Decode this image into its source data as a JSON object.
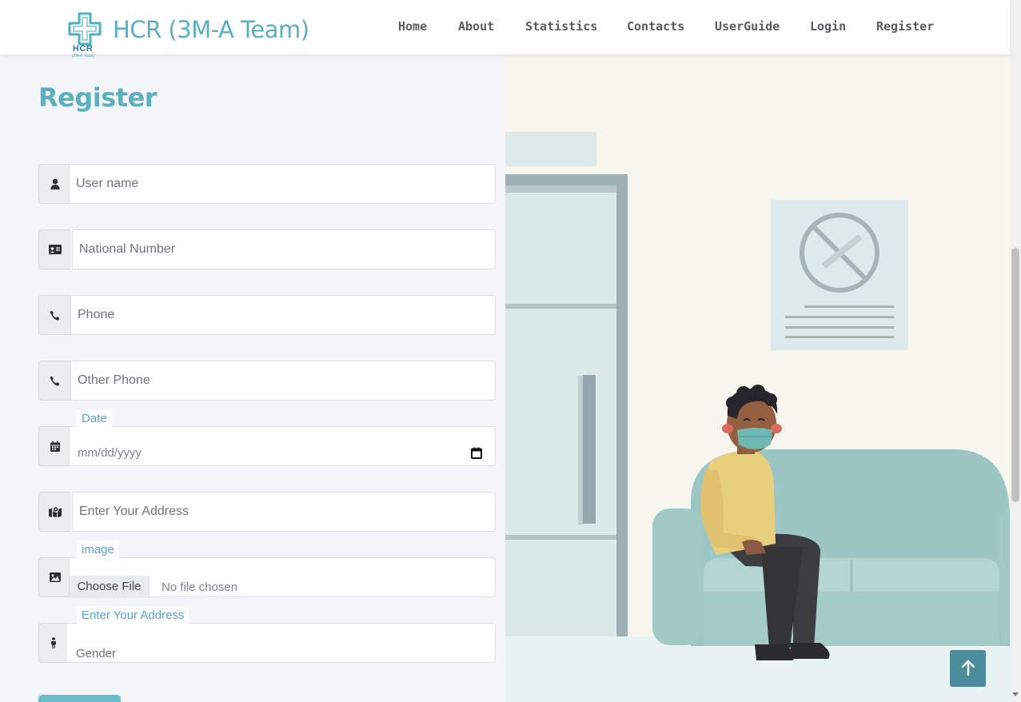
{
  "brand": {
    "logo_text": "HCR",
    "logo_subtext": "(3M-A Team)",
    "title": "HCR (3M-A Team)"
  },
  "nav": {
    "items": [
      {
        "label": "Home"
      },
      {
        "label": "About"
      },
      {
        "label": "Statistics"
      },
      {
        "label": "Contacts"
      },
      {
        "label": "UserGuide"
      },
      {
        "label": "Login"
      },
      {
        "label": "Register"
      }
    ]
  },
  "form": {
    "title": "Register",
    "username": {
      "placeholder": "User name"
    },
    "national_number": {
      "placeholder": "National Number"
    },
    "phone": {
      "placeholder": "Phone"
    },
    "other_phone": {
      "placeholder": "Other Phone"
    },
    "date": {
      "label": "Date",
      "placeholder": "mm/dd/yyyy"
    },
    "address": {
      "placeholder": "Enter Your Address"
    },
    "image": {
      "label": "image",
      "button": "Choose File",
      "status": "No file chosen"
    },
    "gender": {
      "label": "Enter Your Address",
      "value": "Gender"
    }
  },
  "colors": {
    "brand": "#5ab0be",
    "label_blue": "#5a9fd0",
    "back_to_top": "#4a8c9b"
  },
  "icons": {
    "username": "user-icon",
    "national_number": "id-card-icon",
    "phone": "phone-icon",
    "other_phone": "phone-icon",
    "date": "calendar-icon",
    "address": "map-icon",
    "image": "image-icon",
    "gender": "person-icon",
    "back_to_top": "arrow-up-icon"
  }
}
